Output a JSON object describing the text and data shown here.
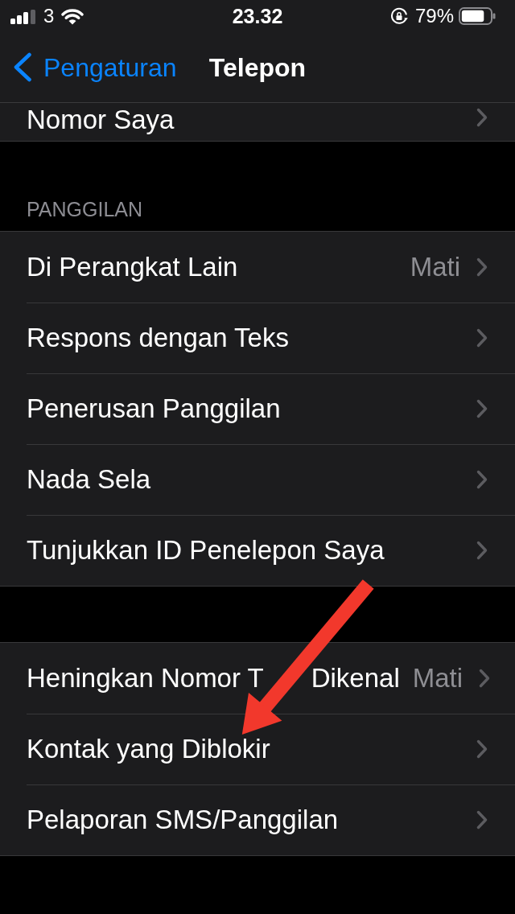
{
  "status_bar": {
    "carrier": "3",
    "time": "23.32",
    "battery_percent": "79%"
  },
  "nav_bar": {
    "back_label": "Pengaturan",
    "title": "Telepon"
  },
  "sections": [
    {
      "kind": "partial",
      "rows": [
        {
          "label": "Nomor Saya"
        }
      ]
    },
    {
      "kind": "full",
      "header": "PANGGILAN",
      "rows": [
        {
          "label": "Di Perangkat Lain",
          "value": "Mati"
        },
        {
          "label": "Respons dengan Teks"
        },
        {
          "label": "Penerusan Panggilan"
        },
        {
          "label": "Nada Sela"
        },
        {
          "label": "Tunjukkan ID Penelepon Saya"
        }
      ]
    },
    {
      "kind": "full",
      "rows": [
        {
          "label": "Heningkan Nomor T",
          "label_tail": "Dikenal",
          "value": "Mati"
        },
        {
          "label": "Kontak yang Diblokir"
        },
        {
          "label": "Pelaporan SMS/Panggilan"
        }
      ]
    }
  ]
}
